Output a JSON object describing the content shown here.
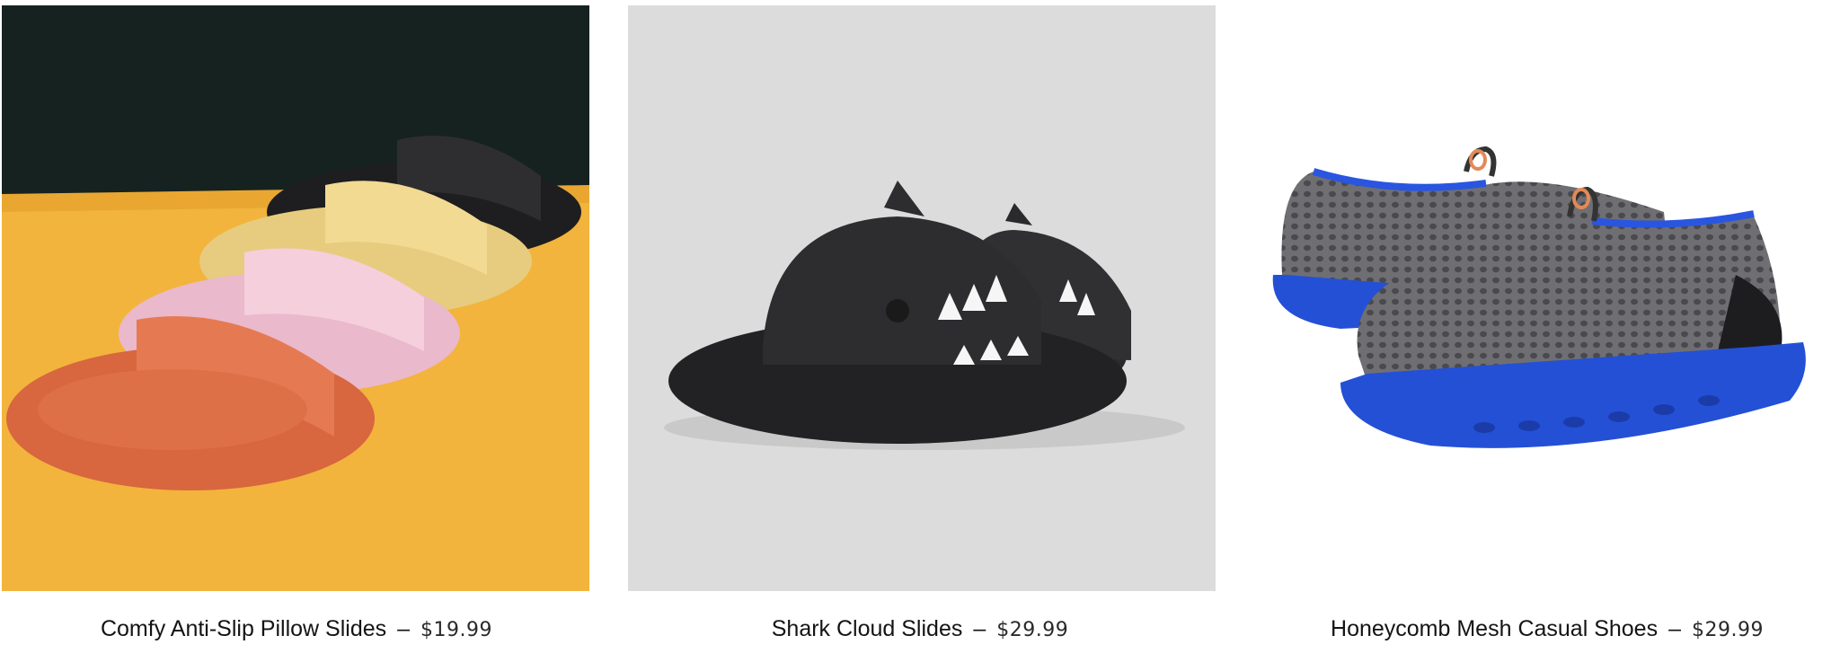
{
  "products": [
    {
      "name": "Comfy Anti-Slip Pillow Slides",
      "separator": "–",
      "price": "$19.99",
      "image_icon": "pillow-slides-photo",
      "colors": [
        "#e2734f",
        "#f3c7d6",
        "#f0d68a",
        "#2b2b2d"
      ]
    },
    {
      "name": "Shark Cloud Slides",
      "separator": "–",
      "price": "$29.99",
      "image_icon": "shark-slides-photo",
      "colors": [
        "#2c2c2e"
      ]
    },
    {
      "name": "Honeycomb Mesh Casual Shoes",
      "separator": "–",
      "price": "$29.99",
      "image_icon": "mesh-shoes-photo",
      "colors": [
        "#6b6b6f",
        "#2450d6"
      ]
    }
  ]
}
